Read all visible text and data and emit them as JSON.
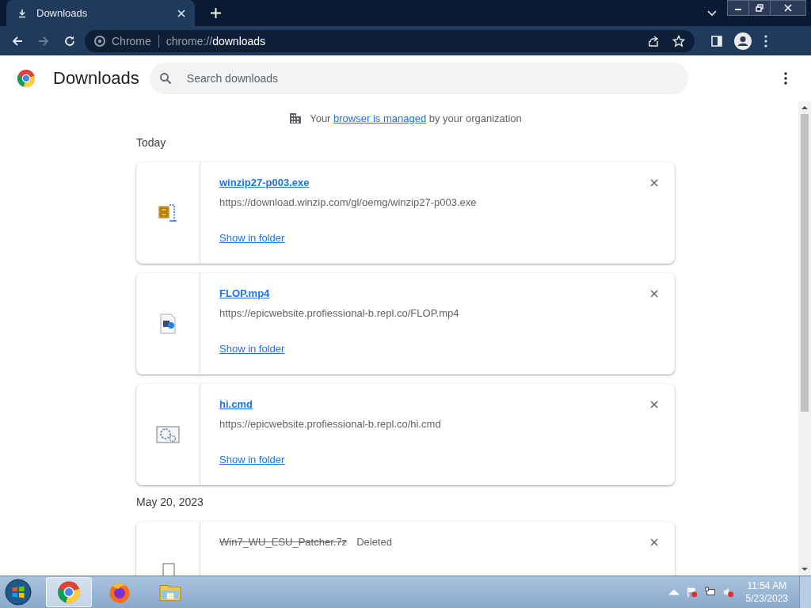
{
  "window": {
    "tab_title": "Downloads",
    "site_label": "Chrome",
    "address_scheme": "chrome://",
    "address_path": "downloads"
  },
  "page": {
    "title": "Downloads",
    "search": {
      "placeholder": "Search downloads"
    },
    "managed_notice": {
      "before": "Your",
      "link": "browser is managed",
      "after": "by your organization"
    },
    "sections": [
      {
        "date": "Today",
        "items": [
          {
            "kind": "archive",
            "name": "winzip27-p003.exe",
            "url": "https://download.winzip.com/gl/oemg/winzip27-p003.exe",
            "action": "Show in folder",
            "deleted": false
          },
          {
            "kind": "video",
            "name": "FLOP.mp4",
            "url": "https://epicwebsite.profiessional-b.repl.co/FLOP.mp4",
            "action": "Show in folder",
            "deleted": false
          },
          {
            "kind": "script",
            "name": "hi.cmd",
            "url": "https://epicwebsite.profiessional-b.repl.co/hi.cmd",
            "action": "Show in folder",
            "deleted": false
          }
        ]
      },
      {
        "date": "May 20, 2023",
        "items": [
          {
            "kind": "file",
            "name": "Win7_WU_ESU_Patcher.7z",
            "status": "Deleted",
            "deleted": true
          }
        ]
      }
    ]
  },
  "taskbar": {
    "apps": [
      {
        "kind": "chrome",
        "selected": true
      },
      {
        "kind": "firefox",
        "selected": false
      },
      {
        "kind": "folder",
        "selected": false
      }
    ],
    "clock": {
      "time": "11:54 AM",
      "date": "5/23/2023"
    }
  }
}
